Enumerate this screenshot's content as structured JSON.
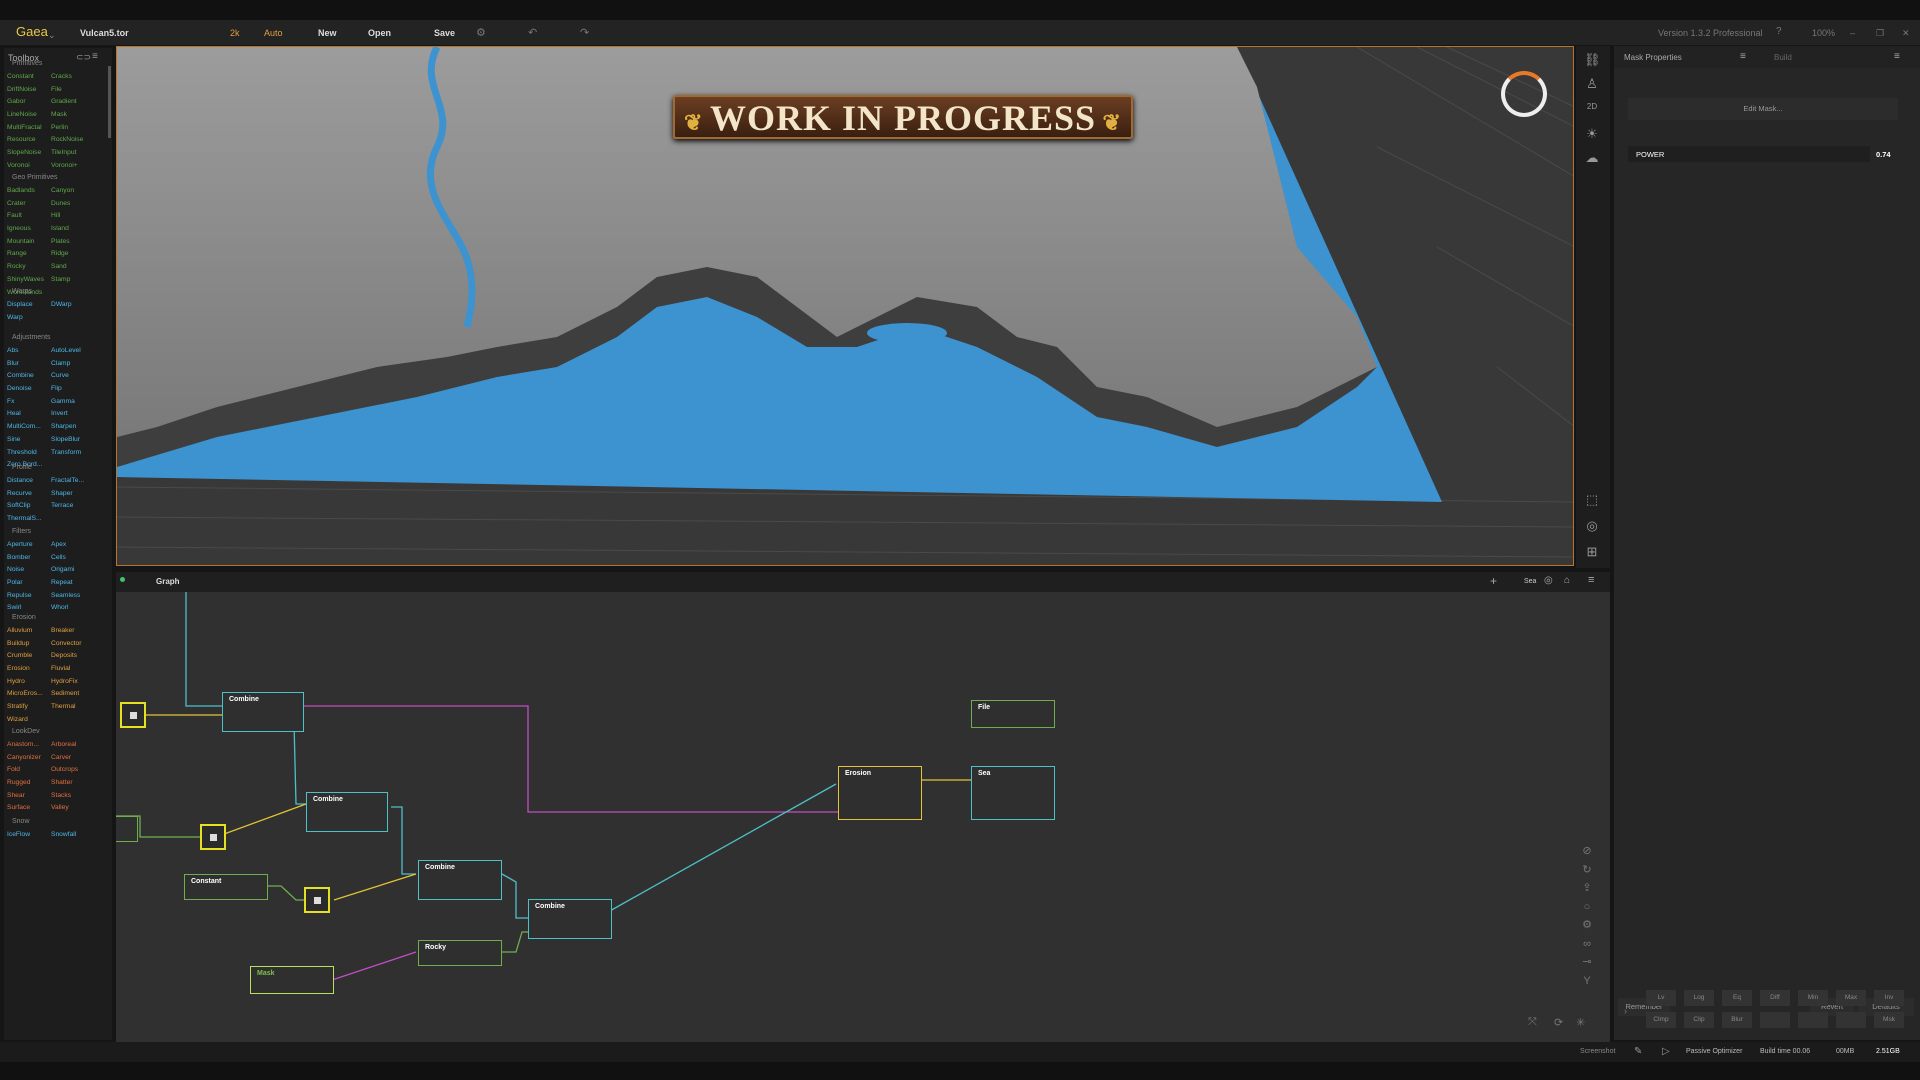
{
  "app": {
    "name": "Gaea",
    "file": "Vulcan5.tor",
    "resolution": "2k",
    "mode": "Auto",
    "version": "Version 1.3.2 Professional",
    "zoom": "100%"
  },
  "menu": {
    "new": "New",
    "open": "Open",
    "save": "Save"
  },
  "toolbox": {
    "title": "Toolbox",
    "sections": [
      {
        "name": "Primitives",
        "items": [
          "Constant",
          "Cracks",
          "DriftNoise",
          "File",
          "Gabor",
          "Gradient",
          "LineNoise",
          "Mask",
          "MultiFractal",
          "Perlin",
          "Resource",
          "RockNoise",
          "SlopeNoise",
          "TileInput",
          "Voronoi",
          "Voronoi+"
        ]
      },
      {
        "name": "Geo Primitives",
        "items": [
          "Badlands",
          "Canyon",
          "Crater",
          "Dunes",
          "Fault",
          "Hill",
          "Igneous",
          "Island",
          "Mountain",
          "Plates",
          "Range",
          "Ridge",
          "Rocky",
          "Sand",
          "ShinyWaves",
          "Stamp",
          "Worselands"
        ]
      },
      {
        "name": "Warps",
        "items": [
          "Displace",
          "DWarp",
          "Warp"
        ]
      },
      {
        "name": "Adjustments",
        "items": [
          "Abs",
          "AutoLevel",
          "Blur",
          "Clamp",
          "Combine",
          "Curve",
          "Denoise",
          "Flip",
          "Fx",
          "Gamma",
          "Heal",
          "Invert",
          "MultiCom...",
          "Sharpen",
          "Sine",
          "SlopeBlur",
          "Threshold",
          "Transform",
          "Zero Bord..."
        ]
      },
      {
        "name": "Profile",
        "items": [
          "Distance",
          "FractalTe...",
          "Recurve",
          "Shaper",
          "SoftClip",
          "Terrace",
          "ThermalS..."
        ]
      },
      {
        "name": "Filters",
        "items": [
          "Aperture",
          "Apex",
          "Bomber",
          "Cells",
          "Noise",
          "Origami",
          "Polar",
          "Repeat",
          "Repulse",
          "Seamless",
          "Swirl",
          "Whorl"
        ]
      },
      {
        "name": "Erosion",
        "items": [
          "Alluvium",
          "Breaker",
          "Buildup",
          "Convector",
          "Crumble",
          "Deposits",
          "Erosion",
          "Fluvial",
          "Hydro",
          "HydroFix",
          "MicroEros...",
          "Sediment",
          "Stratify",
          "Thermal",
          "Wizard"
        ]
      },
      {
        "name": "LookDev",
        "items": [
          "Anastom...",
          "Arboreal",
          "Canyonizer",
          "Carver",
          "Fold",
          "Outcrops",
          "Rugged",
          "Shatter",
          "Shear",
          "Stacks",
          "Surface",
          "Valley"
        ]
      },
      {
        "name": "Snow",
        "items": [
          "IceFlow",
          "Snowfall"
        ]
      }
    ]
  },
  "viewport": {
    "banner": "WORK IN PROGRESS",
    "view_label": "2D"
  },
  "graph": {
    "tab": "Graph",
    "sea_label": "Sea",
    "nodes": {
      "combine1": "Combine",
      "combine2": "Combine",
      "combine3": "Combine",
      "combine4": "Combine",
      "constant": "Constant",
      "rocky": "Rocky",
      "mask": "Mask",
      "erosion": "Erosion",
      "sea": "Sea",
      "file": "File"
    }
  },
  "props": {
    "tab": "Mask Properties",
    "build_tab": "Build",
    "edit_mask": "Edit Mask...",
    "power_label": "POWER",
    "power_value": "0.74",
    "remember": "Remember",
    "revert": "Revert",
    "defaults": "Defaults",
    "modifiers_row1": [
      "Lv",
      "Log",
      "Eq",
      "Diff",
      "Min",
      "Max",
      "Inv"
    ],
    "modifiers_row2": [
      "Clmp",
      "Clip",
      "Blur",
      "",
      "",
      "",
      "Msk"
    ]
  },
  "status": {
    "screenshot": "Screenshot",
    "optimizer": "Passive Optimizer",
    "build_time": "Build time 00.06",
    "mem1": "00MB",
    "mem2": "2.51GB"
  },
  "colors": {
    "accent": "#e9c84a",
    "viewport_border": "#b8742a",
    "water": "#3d93cf",
    "node_cyan": "#4dc0c8",
    "node_yellow": "#e2c236"
  }
}
